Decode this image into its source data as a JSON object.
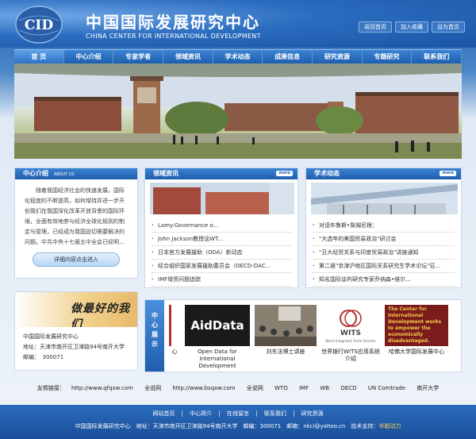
{
  "header": {
    "logo_text": "CID",
    "site_cn": "中国国际发展研究中心",
    "site_en": "CHINA CENTER FOR INTERNATIONAL DEVELOPMENT",
    "top_links": [
      "返回首页",
      "加入收藏",
      "设为首页"
    ]
  },
  "nav": [
    "首 页",
    "中心介绍",
    "专家学者",
    "领域资讯",
    "学术动态",
    "成果信息",
    "研究资源",
    "专题研究",
    "联系我们"
  ],
  "intro": {
    "title": "中心介绍",
    "title_en": "ABOUT US",
    "text": "随着我国经济社会的快速发展，国际化程度的不断提高，如何增持并进一步开创我们在我国深化改革开放背景的国际环境，全面有效地参与经济全球化规则的制定与管理，已经成为我国迫切需要解决的问题。中共中央十七届五中全会已经明...",
    "button": "详细内容点击进入"
  },
  "field_news": {
    "title": "领域资讯",
    "more": "more",
    "items": [
      "Lamy:Governance o...",
      "John Jackson教授谈WT...",
      "日本官方发展援助（ODA）新动态",
      "经合组织国家发展援助委员会（OECD-DAC...",
      "IMF增资问题追踪"
    ]
  },
  "academic": {
    "title": "学术动态",
    "more": "more",
    "items": [
      "对话布鲁斯•詹姆尼根：",
      "\"大选年的美国贸易政治\"研讨会",
      "\"丑大经贸关系与印度贸易政治\"讲座通知",
      "第二届\"京津沪地区国际关系研究生学术论坛\"征...",
      "知名国际谈判研究专家乔纳森•维尔..."
    ]
  },
  "contact": {
    "signature": "做最好的我们",
    "name": "中国国际发展研究中心",
    "address": "地址：天津市南开区卫津路94号南开大学",
    "postcode": "邮编：　300071"
  },
  "center_show": {
    "label": "中心展示",
    "items": [
      {
        "caption": "心",
        "logo": ""
      },
      {
        "caption": "Open Data for International Development",
        "logo": "AidData"
      },
      {
        "caption": "刘东法博士讲座",
        "logo": ""
      },
      {
        "caption": "世界银行WITS应用系统介绍",
        "logo": "WITS"
      },
      {
        "caption": "哈佛大学国际发展中心",
        "logo": "The Center for International Development works to empower the economically disadvantaged."
      }
    ],
    "wits_sub": "World Integrated Trade Solution"
  },
  "friends": {
    "label": "友情链接：",
    "links": [
      "http://www.qfqxw.com",
      "全说网",
      "http://www.bsqxw.com",
      "全说网",
      "WTO",
      "IMF",
      "WB",
      "OECD",
      "UN Comtrade",
      "南开大学"
    ]
  },
  "footer": {
    "links": [
      "网站首页",
      "|",
      "中心简介",
      "|",
      "在线留言",
      "|",
      "联系我们",
      "|",
      "研究资源"
    ],
    "info": "中国国际发展研究中心　地址：天津市南开区卫津路94号南开大学　邮编：300071　邮箱：nkci@yahoo.cn　技术支持：",
    "support": "华聪动力"
  },
  "colors": {
    "primary": "#1f5eae",
    "accent": "#3b82d2",
    "highlight": "#ffd34d"
  }
}
